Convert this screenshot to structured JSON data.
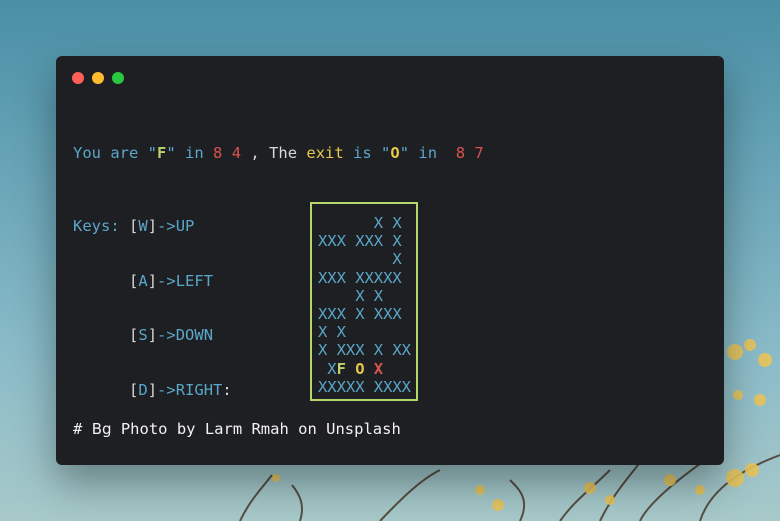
{
  "window": {
    "buttons": [
      {
        "name": "close",
        "color": "#ff5f57"
      },
      {
        "name": "minimize",
        "color": "#febc2e"
      },
      {
        "name": "zoom",
        "color": "#28c840"
      }
    ]
  },
  "status": {
    "you_are": "You are \"",
    "player_char": "F",
    "in_1": "\" in ",
    "player_row": "8",
    "player_col": "4",
    "sep": " , The ",
    "exit_word": "exit",
    "is": " is \"",
    "exit_char": "O",
    "in_2": "\" in  ",
    "exit_row": "8",
    "exit_col": "7"
  },
  "keys": {
    "label": "Keys: ",
    "items": [
      {
        "key": "W",
        "arrow": "->",
        "action": "UP",
        "suffix": ""
      },
      {
        "key": "A",
        "arrow": "->",
        "action": "LEFT",
        "suffix": ""
      },
      {
        "key": "S",
        "arrow": "->",
        "action": "DOWN",
        "suffix": ""
      },
      {
        "key": "D",
        "arrow": "->",
        "action": "RIGHT",
        "suffix": ":"
      }
    ]
  },
  "maze": {
    "rows": [
      "      X X",
      "XXX XXX X",
      "        X",
      "XXX XXXXX",
      "    X X  ",
      "XXX X XXX",
      "X X      ",
      "X XXX X XX",
      " XF O X  ",
      "XXXXX XXXX"
    ]
  },
  "credit": {
    "hash": "#",
    "bg": "Bg",
    "text": " Photo by Larm Rmah on Unsplash"
  },
  "colors": {
    "border": "#b5d56d",
    "text_blue": "#5aa7c9",
    "red": "#d9534f",
    "yellow": "#e6c84a",
    "green": "#b7d56a"
  }
}
